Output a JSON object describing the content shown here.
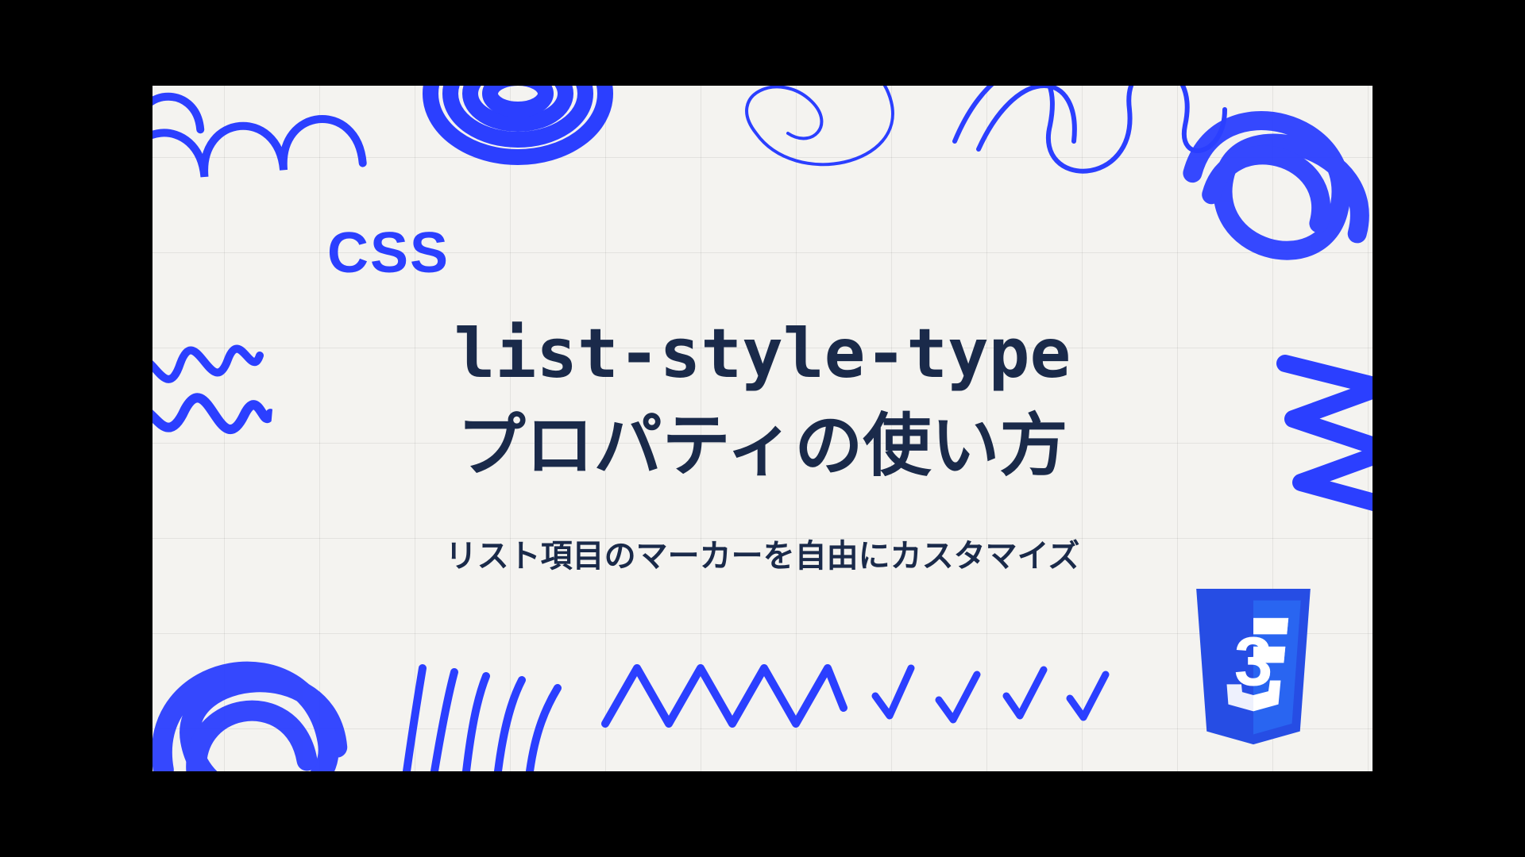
{
  "category": "CSS",
  "title_line1": "list-style-type",
  "title_line2": "プロパティの使い方",
  "subtitle": "リスト項目のマーカーを自由にカスタマイズ",
  "colors": {
    "accent": "#2b3fff",
    "ink": "#1a2a4a",
    "paper": "#f4f3f0",
    "css3_shield": "#264de4",
    "css3_side": "#2965f1"
  },
  "css3_badge_text": "3"
}
